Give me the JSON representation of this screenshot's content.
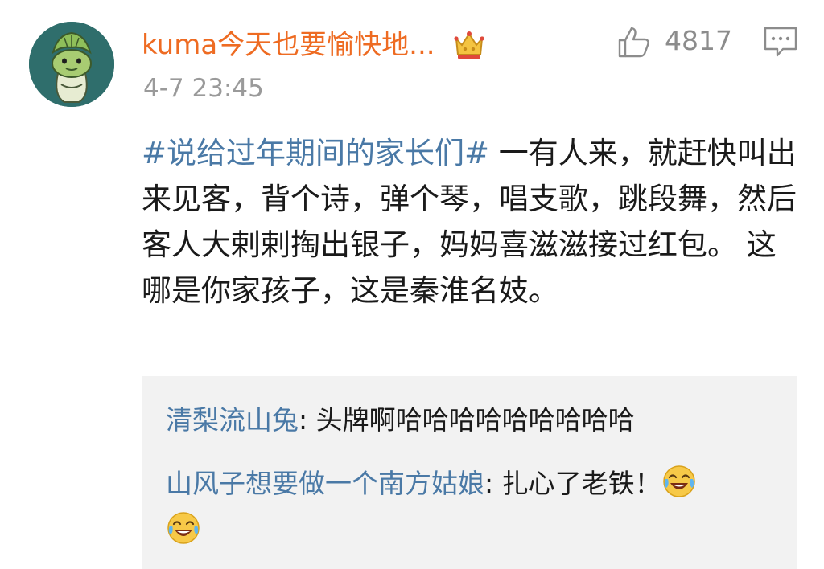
{
  "post": {
    "username": "kuma今天也要愉快地...",
    "timestamp": "4-7 23:45",
    "like_count": "4817",
    "hashtag": "#说给过年期间的家长们#",
    "text": " 一有人来，就赶快叫出来见客，背个诗，弹个琴，唱支歌，跳段舞，然后客人大剌剌掏出银子，妈妈喜滋滋接过红包。 这哪是你家孩子，这是秦淮名妓。"
  },
  "icons": {
    "avatar": "cabbage-frog-avatar",
    "badge": "crown-icon",
    "like": "thumbs-up-icon",
    "comment": "comment-icon",
    "emoji": "laughing-crying-emoji"
  },
  "replies": [
    {
      "user": "清梨流山兔",
      "sep": ": ",
      "text": "头牌啊哈哈哈哈哈哈哈哈哈"
    },
    {
      "user": "山风子想要做一个南方姑娘",
      "sep": ": ",
      "text": "扎心了老铁！"
    }
  ],
  "colors": {
    "username": "#ee6b22",
    "link": "#4a79a6",
    "body_text": "#1a1a1a",
    "meta_text": "#9a9a9a",
    "reply_background": "#f2f2f2"
  }
}
